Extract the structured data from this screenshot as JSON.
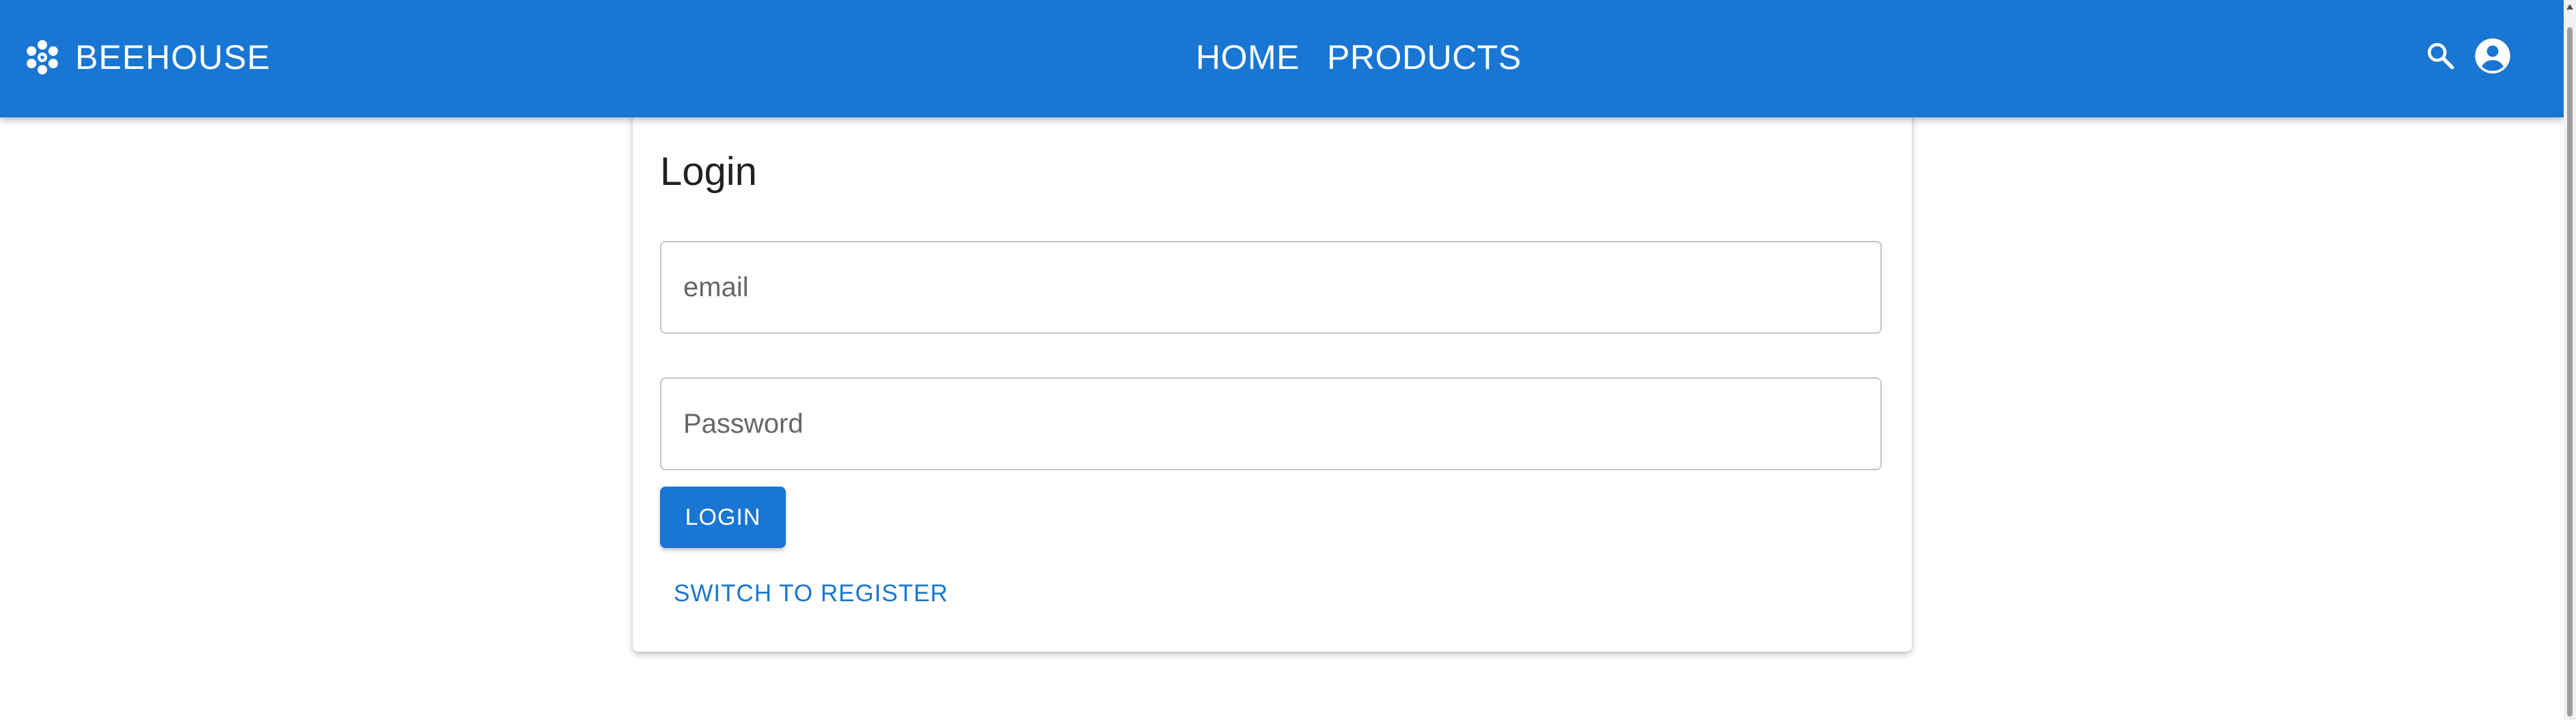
{
  "header": {
    "brand_name": "BEEHOUSE",
    "brand_icon": "hive-icon",
    "nav": [
      {
        "label": "HOME"
      },
      {
        "label": "PRODUCTS"
      }
    ],
    "actions": [
      {
        "icon": "search-icon"
      },
      {
        "icon": "account-circle-icon"
      }
    ]
  },
  "login_card": {
    "title": "Login",
    "email_placeholder": "email",
    "password_placeholder": "Password",
    "login_button_label": "LOGIN",
    "switch_link_label": "SWITCH TO REGISTER"
  },
  "colors": {
    "primary": "#1976d2",
    "on_primary": "#ffffff",
    "background": "#ffffff"
  }
}
